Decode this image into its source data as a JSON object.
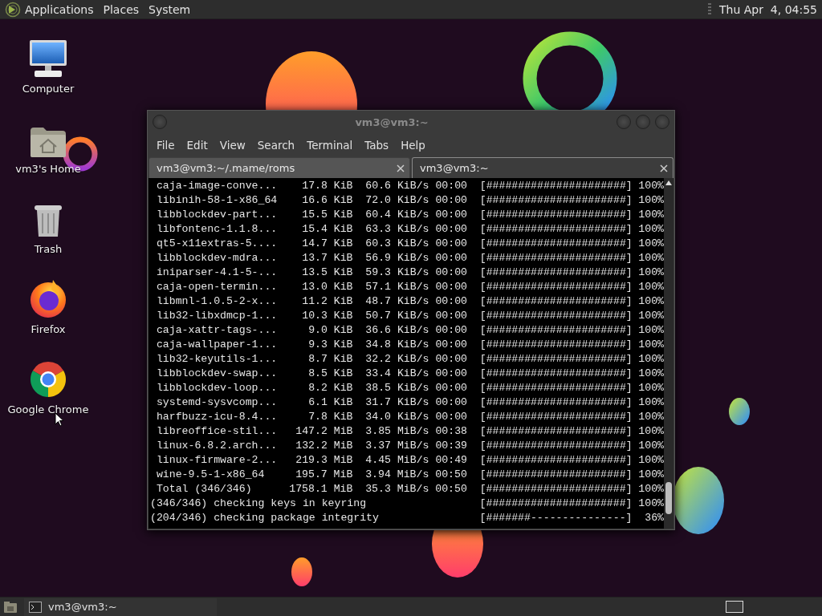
{
  "top_panel": {
    "menus": [
      "Applications",
      "Places",
      "System"
    ],
    "clock": "Thu Apr  4, 04:55"
  },
  "desktop_icons": [
    {
      "label": "Computer",
      "kind": "computer"
    },
    {
      "label": "vm3's Home",
      "kind": "home"
    },
    {
      "label": "Trash",
      "kind": "trash"
    },
    {
      "label": "Firefox",
      "kind": "firefox"
    },
    {
      "label": "Google Chrome",
      "kind": "chrome"
    }
  ],
  "terminal_window": {
    "title": "vm3@vm3:~",
    "menu": [
      "File",
      "Edit",
      "View",
      "Search",
      "Terminal",
      "Tabs",
      "Help"
    ],
    "tabs": [
      {
        "label": "vm3@vm3:~/.mame/roms",
        "selected": false
      },
      {
        "label": "vm3@vm3:~",
        "selected": true
      }
    ],
    "transfers": [
      {
        "name": "caja-image-conve...",
        "size": "17.8 KiB",
        "rate": "60.6 KiB/s",
        "time": "00:00",
        "bar": "[######################]",
        "percent": "100%"
      },
      {
        "name": "libinih-58-1-x86_64",
        "size": "16.6 KiB",
        "rate": "72.0 KiB/s",
        "time": "00:00",
        "bar": "[######################]",
        "percent": "100%"
      },
      {
        "name": "libblockdev-part...",
        "size": "15.5 KiB",
        "rate": "60.4 KiB/s",
        "time": "00:00",
        "bar": "[######################]",
        "percent": "100%"
      },
      {
        "name": "libfontenc-1.1.8...",
        "size": "15.4 KiB",
        "rate": "63.3 KiB/s",
        "time": "00:00",
        "bar": "[######################]",
        "percent": "100%"
      },
      {
        "name": "qt5-x11extras-5....",
        "size": "14.7 KiB",
        "rate": "60.3 KiB/s",
        "time": "00:00",
        "bar": "[######################]",
        "percent": "100%"
      },
      {
        "name": "libblockdev-mdra...",
        "size": "13.7 KiB",
        "rate": "56.9 KiB/s",
        "time": "00:00",
        "bar": "[######################]",
        "percent": "100%"
      },
      {
        "name": "iniparser-4.1-5-...",
        "size": "13.5 KiB",
        "rate": "59.3 KiB/s",
        "time": "00:00",
        "bar": "[######################]",
        "percent": "100%"
      },
      {
        "name": "caja-open-termin...",
        "size": "13.0 KiB",
        "rate": "57.1 KiB/s",
        "time": "00:00",
        "bar": "[######################]",
        "percent": "100%"
      },
      {
        "name": "libmnl-1.0.5-2-x...",
        "size": "11.2 KiB",
        "rate": "48.7 KiB/s",
        "time": "00:00",
        "bar": "[######################]",
        "percent": "100%"
      },
      {
        "name": "lib32-libxdmcp-1...",
        "size": "10.3 KiB",
        "rate": "50.7 KiB/s",
        "time": "00:00",
        "bar": "[######################]",
        "percent": "100%"
      },
      {
        "name": "caja-xattr-tags-...",
        "size": "9.0 KiB",
        "rate": "36.6 KiB/s",
        "time": "00:00",
        "bar": "[######################]",
        "percent": "100%"
      },
      {
        "name": "caja-wallpaper-1...",
        "size": "9.3 KiB",
        "rate": "34.8 KiB/s",
        "time": "00:00",
        "bar": "[######################]",
        "percent": "100%"
      },
      {
        "name": "lib32-keyutils-1...",
        "size": "8.7 KiB",
        "rate": "32.2 KiB/s",
        "time": "00:00",
        "bar": "[######################]",
        "percent": "100%"
      },
      {
        "name": "libblockdev-swap...",
        "size": "8.5 KiB",
        "rate": "33.4 KiB/s",
        "time": "00:00",
        "bar": "[######################]",
        "percent": "100%"
      },
      {
        "name": "libblockdev-loop...",
        "size": "8.2 KiB",
        "rate": "38.5 KiB/s",
        "time": "00:00",
        "bar": "[######################]",
        "percent": "100%"
      },
      {
        "name": "systemd-sysvcomp...",
        "size": "6.1 KiB",
        "rate": "31.7 KiB/s",
        "time": "00:00",
        "bar": "[######################]",
        "percent": "100%"
      },
      {
        "name": "harfbuzz-icu-8.4...",
        "size": "7.8 KiB",
        "rate": "34.0 KiB/s",
        "time": "00:00",
        "bar": "[######################]",
        "percent": "100%"
      },
      {
        "name": "libreoffice-stil...",
        "size": "147.2 MiB",
        "rate": "3.85 MiB/s",
        "time": "00:38",
        "bar": "[######################]",
        "percent": "100%"
      },
      {
        "name": "linux-6.8.2.arch...",
        "size": "132.2 MiB",
        "rate": "3.37 MiB/s",
        "time": "00:39",
        "bar": "[######################]",
        "percent": "100%"
      },
      {
        "name": "linux-firmware-2...",
        "size": "219.3 MiB",
        "rate": "4.45 MiB/s",
        "time": "00:49",
        "bar": "[######################]",
        "percent": "100%"
      },
      {
        "name": "wine-9.5-1-x86_64",
        "size": "195.7 MiB",
        "rate": "3.94 MiB/s",
        "time": "00:50",
        "bar": "[######################]",
        "percent": "100%"
      },
      {
        "name": "Total (346/346)",
        "size": "1758.1 MiB",
        "rate": "35.3 MiB/s",
        "time": "00:50",
        "bar": "[######################]",
        "percent": "100%"
      }
    ],
    "checks": [
      {
        "text": "(346/346) checking keys in keyring",
        "bar": "[######################]",
        "percent": "100%"
      },
      {
        "text": "(204/346) checking package integrity",
        "bar": "[#######---------------]",
        "percent": "36%"
      }
    ]
  },
  "bottom_panel": {
    "tasks": [
      "vm3@vm3:~"
    ]
  }
}
